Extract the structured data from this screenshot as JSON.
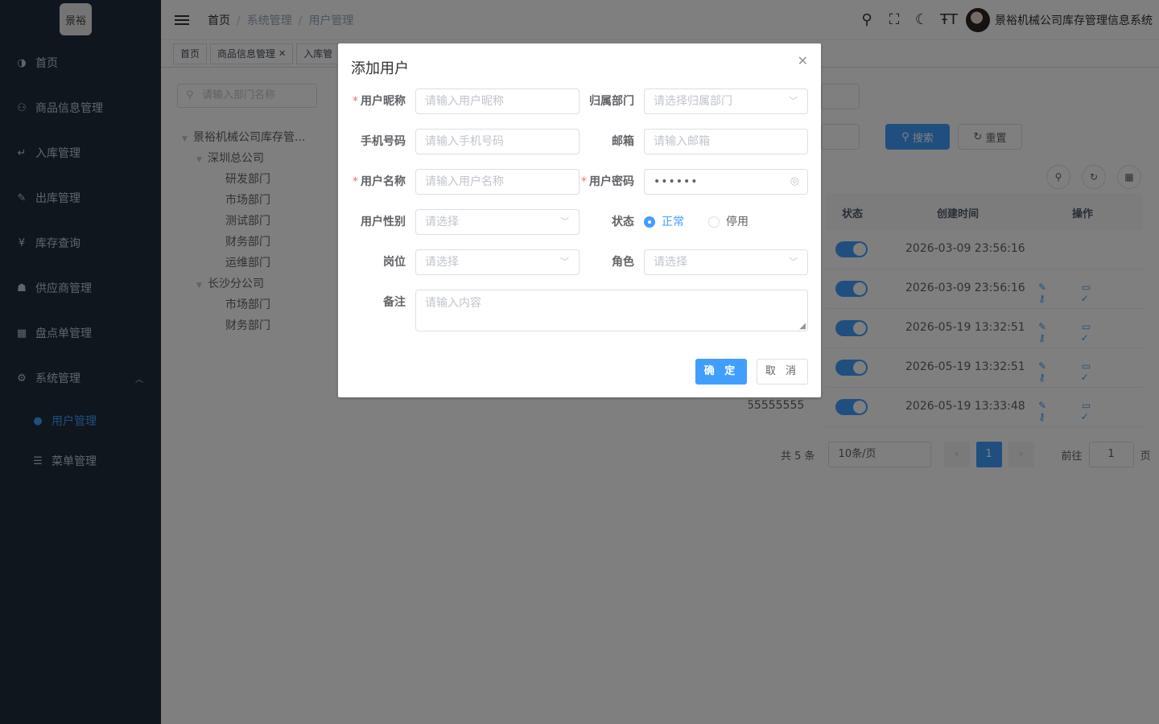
{
  "logo": {
    "text": "景裕"
  },
  "sidebar": {
    "items": [
      {
        "label": "首页",
        "icon": "dashboard-icon"
      },
      {
        "label": "商品信息管理",
        "icon": "tree-icon"
      },
      {
        "label": "入库管理",
        "icon": "enter-icon"
      },
      {
        "label": "出库管理",
        "icon": "edit-icon"
      },
      {
        "label": "库存查询",
        "icon": "yen-icon"
      },
      {
        "label": "供应商管理",
        "icon": "peoples-icon"
      },
      {
        "label": "盘点单管理",
        "icon": "table-icon"
      },
      {
        "label": "系统管理",
        "icon": "gear-icon"
      }
    ],
    "subitems": [
      {
        "label": "用户管理",
        "icon": "user-icon"
      },
      {
        "label": "菜单管理",
        "icon": "tree-table-icon"
      }
    ]
  },
  "header": {
    "breadcrumb": [
      "首页",
      "系统管理",
      "用户管理"
    ],
    "user_name": "景裕机械公司库存管理信息系统"
  },
  "tags": [
    "首页",
    "商品信息管理",
    "入库管"
  ],
  "dept": {
    "search_placeholder": "请输入部门名称",
    "tree": [
      {
        "label": "景裕机械公司库存管...",
        "level": 0
      },
      {
        "label": "深圳总公司",
        "level": 1
      },
      {
        "label": "研发部门",
        "level": 2
      },
      {
        "label": "市场部门",
        "level": 2
      },
      {
        "label": "测试部门",
        "level": 2
      },
      {
        "label": "财务部门",
        "level": 2
      },
      {
        "label": "运维部门",
        "level": 2
      },
      {
        "label": "长沙分公司",
        "level": 1
      },
      {
        "label": "市场部门",
        "level": 2
      },
      {
        "label": "财务部门",
        "level": 2
      }
    ]
  },
  "query": {
    "search_label": "搜索",
    "reset_label": "重置"
  },
  "table": {
    "headers": {
      "status": "状态",
      "created": "创建时间",
      "ops": "操作"
    },
    "rows": [
      {
        "created": "2026-03-09 23:56:16",
        "ops": ""
      },
      {
        "created": "2026-03-09 23:56:16",
        "ops": "✎ ▭ ⚷ ✓"
      },
      {
        "created": "2026-05-19 13:32:51",
        "ops": "✎ ▭ ⚷ ✓"
      },
      {
        "created": "2026-05-19 13:32:51",
        "ops": "✎ ▭ ⚷ ✓"
      },
      {
        "created": "2026-05-19 13:33:48",
        "ops": "✎ ▭ ⚷ ✓"
      }
    ],
    "phone_fragment": "55555555"
  },
  "pager": {
    "total": "共 5 条",
    "size": "10条/页",
    "current": "1",
    "goto_label": "前往",
    "goto_value": "1",
    "page_unit": "页"
  },
  "dialog": {
    "title": "添加用户",
    "close": "✕",
    "nickname": {
      "label": "用户昵称",
      "placeholder": "请输入用户昵称"
    },
    "dept": {
      "label": "归属部门",
      "placeholder": "请选择归属部门"
    },
    "phone": {
      "label": "手机号码",
      "placeholder": "请输入手机号码"
    },
    "email": {
      "label": "邮箱",
      "placeholder": "请输入邮箱"
    },
    "username": {
      "label": "用户名称",
      "placeholder": "请输入用户名称"
    },
    "password": {
      "label": "用户密码",
      "value": "••••••"
    },
    "sex": {
      "label": "用户性别",
      "placeholder": "请选择"
    },
    "status": {
      "label": "状态",
      "options": [
        "正常",
        "停用"
      ],
      "selected": "正常"
    },
    "post": {
      "label": "岗位",
      "placeholder": "请选择"
    },
    "role": {
      "label": "角色",
      "placeholder": "请选择"
    },
    "remark": {
      "label": "备注",
      "placeholder": "请输入内容"
    },
    "ok_label": "确 定",
    "cancel_label": "取 消"
  },
  "colors": {
    "primary": "#409eff",
    "sidebar_bg": "#1f2d3d",
    "required": "#f56c6c"
  }
}
